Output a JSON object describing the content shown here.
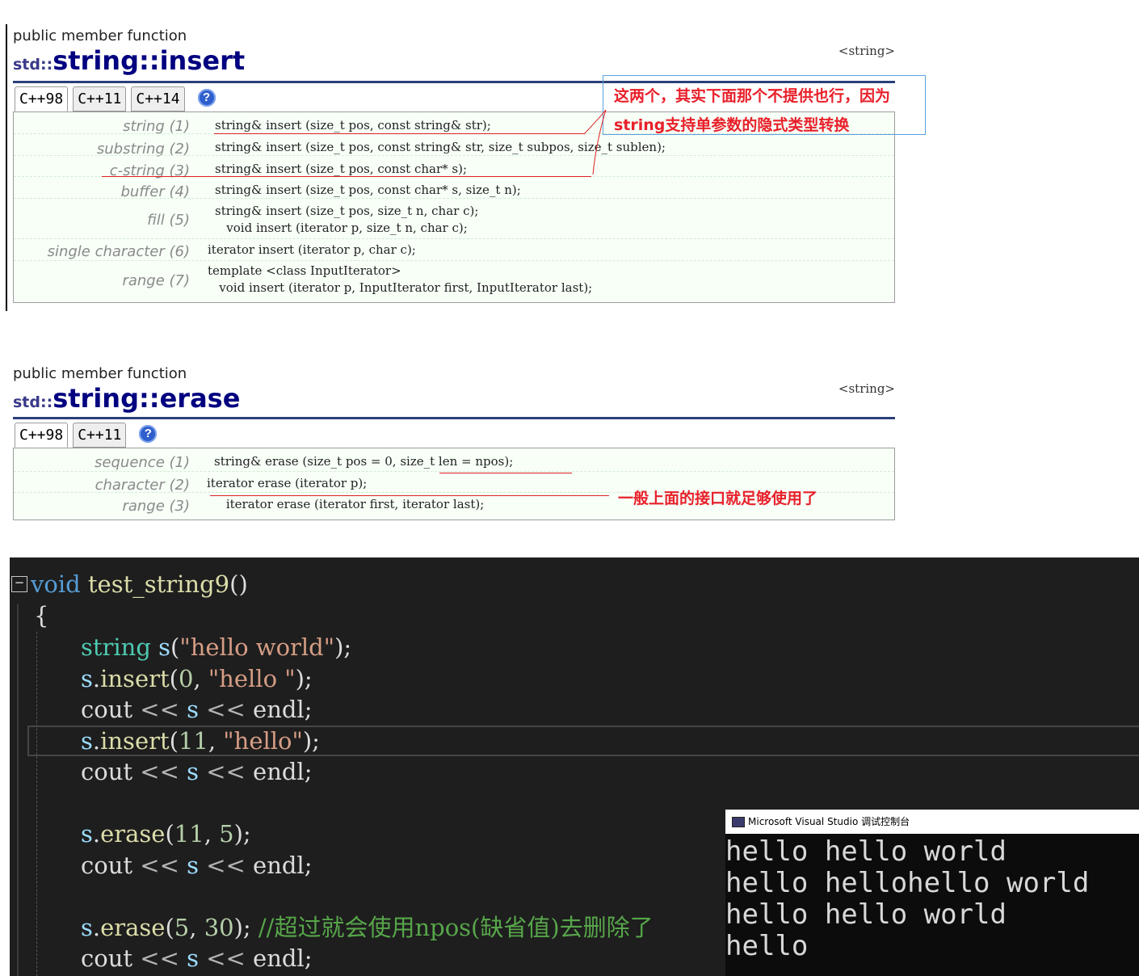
{
  "insert_ref": {
    "kind": "public member function",
    "ns": "std::",
    "name": "string::insert",
    "header": "<string>",
    "tabs": [
      "C++98",
      "C++11",
      "C++14"
    ],
    "help": "?",
    "rows": [
      {
        "label": "string (1)",
        "code": "string& insert (size_t pos, const string& str);"
      },
      {
        "label": "substring (2)",
        "code": "string& insert (size_t pos, const string& str, size_t subpos, size_t sublen);"
      },
      {
        "label": "c-string (3)",
        "code": "string& insert (size_t pos, const char* s);"
      },
      {
        "label": "buffer (4)",
        "code": "string& insert (size_t pos, const char* s, size_t n);"
      },
      {
        "label": "fill (5)",
        "code": "string& insert (size_t pos, size_t n, char c);\n   void insert (iterator p, size_t n, char c);"
      },
      {
        "label": "single character (6)",
        "code": "iterator insert (iterator p, char c);"
      },
      {
        "label": "range (7)",
        "code": "template <class InputIterator>\n   void insert (iterator p, InputIterator first, InputIterator last);"
      }
    ],
    "note_line1": "这两个，其实下面那个不提供也行，因为",
    "note_line2": "string支持单参数的隐式类型转换"
  },
  "erase_ref": {
    "kind": "public member function",
    "ns": "std::",
    "name": "string::erase",
    "header": "<string>",
    "tabs": [
      "C++98",
      "C++11"
    ],
    "help": "?",
    "rows": [
      {
        "label": "sequence (1)",
        "code": "string& erase (size_t pos = 0, size_t len = npos);"
      },
      {
        "label": "character (2)",
        "code": "iterator erase (iterator p);"
      },
      {
        "label": "range (3)",
        "code": "     iterator erase (iterator first, iterator last);"
      }
    ],
    "note": "一般上面的接口就足够使用了"
  },
  "editor": {
    "fold_symbol": "−",
    "lines": {
      "l1_kw": "void",
      "l1_fn": "test_string9",
      "l1_rest": "()",
      "l2": "{",
      "l3_ty": "string",
      "l3_va": "s",
      "l3_p1": "(",
      "l3_st": "\"hello world\"",
      "l3_p2": ");",
      "l4_va": "s",
      "l4_dot": ".",
      "l4_fn": "insert",
      "l4_p1": "(",
      "l4_nu": "0",
      "l4_c": ", ",
      "l4_st": "\"hello \"",
      "l4_p2": ");",
      "cout": "cout",
      "shl": "<<",
      "endl": "endl",
      "semi": ";",
      "l6_fn": "insert",
      "l6_nu": "11",
      "l6_st": "\"hello\"",
      "erase": "erase",
      "l9_n1": "11",
      "l9_n2": "5",
      "l12_n1": "5",
      "l12_n2": "30",
      "l12_cm": "//超过就会使用npos(缺省值)去删除了"
    }
  },
  "console": {
    "title": "Microsoft Visual Studio 调试控制台",
    "lines": [
      "hello hello world",
      "hello hellohello world",
      "hello hello world",
      "hello"
    ]
  }
}
